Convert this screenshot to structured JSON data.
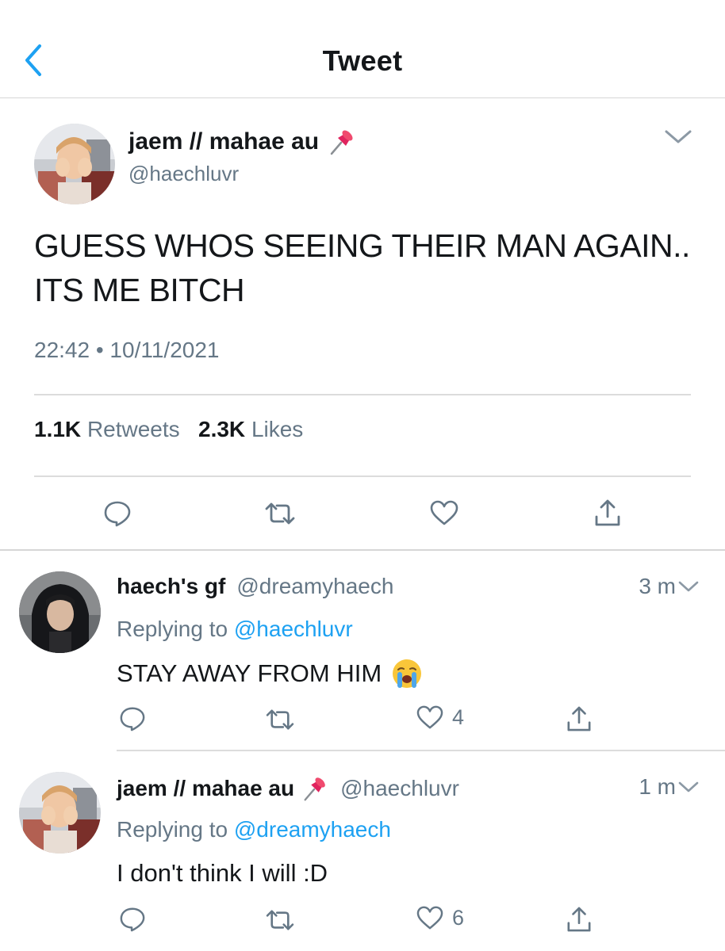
{
  "header": {
    "title": "Tweet"
  },
  "main_tweet": {
    "display_name": "jaem // mahae au",
    "handle": "@haechluvr",
    "text": "GUESS WHOS SEEING THEIR MAN AGAIN.. ITS ME BITCH",
    "timestamp": "22:42 • 10/11/2021",
    "retweets_count": "1.1K",
    "retweets_label": "Retweets",
    "likes_count": "2.3K",
    "likes_label": "Likes"
  },
  "replies": [
    {
      "display_name": "haech's gf",
      "handle": "@dreamyhaech",
      "time": "3 m",
      "replying_prefix": "Replying to",
      "replying_to": "@haechluvr",
      "text": "STAY AWAY FROM HIM",
      "like_count": "4"
    },
    {
      "display_name": "jaem // mahae au",
      "handle": "@haechluvr",
      "time": "1 m",
      "replying_prefix": "Replying to",
      "replying_to": "@dreamyhaech",
      "text": "I don't think I will :D",
      "like_count": "6"
    }
  ],
  "colors": {
    "accent": "#1da1f2",
    "muted": "#657786",
    "text": "#14171a",
    "divider": "#d6d6d6",
    "pin": "#e0245e"
  },
  "icons": [
    "back-chevron-icon",
    "chevron-down-icon",
    "pushpin-icon",
    "reply-icon",
    "retweet-icon",
    "like-icon",
    "share-icon",
    "crying-face-icon"
  ]
}
